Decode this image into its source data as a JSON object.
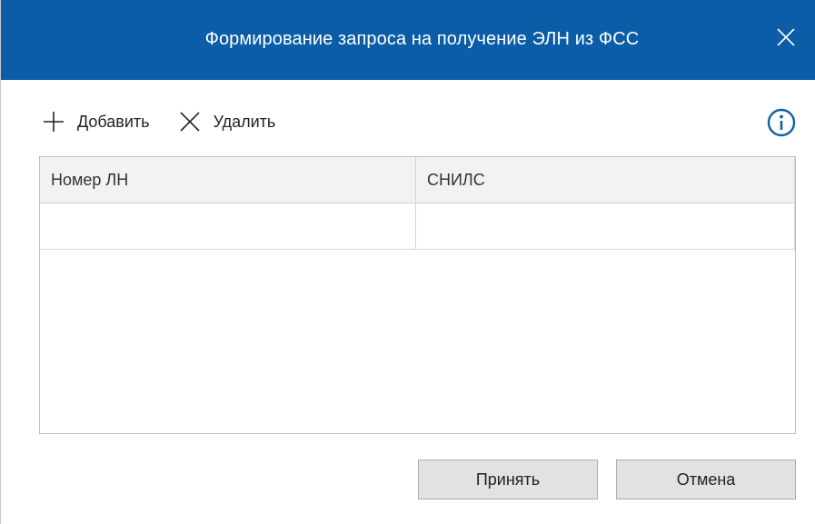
{
  "dialog": {
    "title": "Формирование запроса на получение ЭЛН из ФСС",
    "title_bar_color": "#0a5da6",
    "close_icon": "close-icon"
  },
  "toolbar": {
    "add_label": "Добавить",
    "add_icon": "plus-icon",
    "delete_label": "Удалить",
    "delete_icon": "x-icon",
    "info_icon": "info-icon"
  },
  "grid": {
    "columns": [
      "Номер ЛН",
      "СНИЛС"
    ],
    "rows": [
      [
        "",
        ""
      ]
    ]
  },
  "footer": {
    "accept_label": "Принять",
    "cancel_label": "Отмена"
  }
}
